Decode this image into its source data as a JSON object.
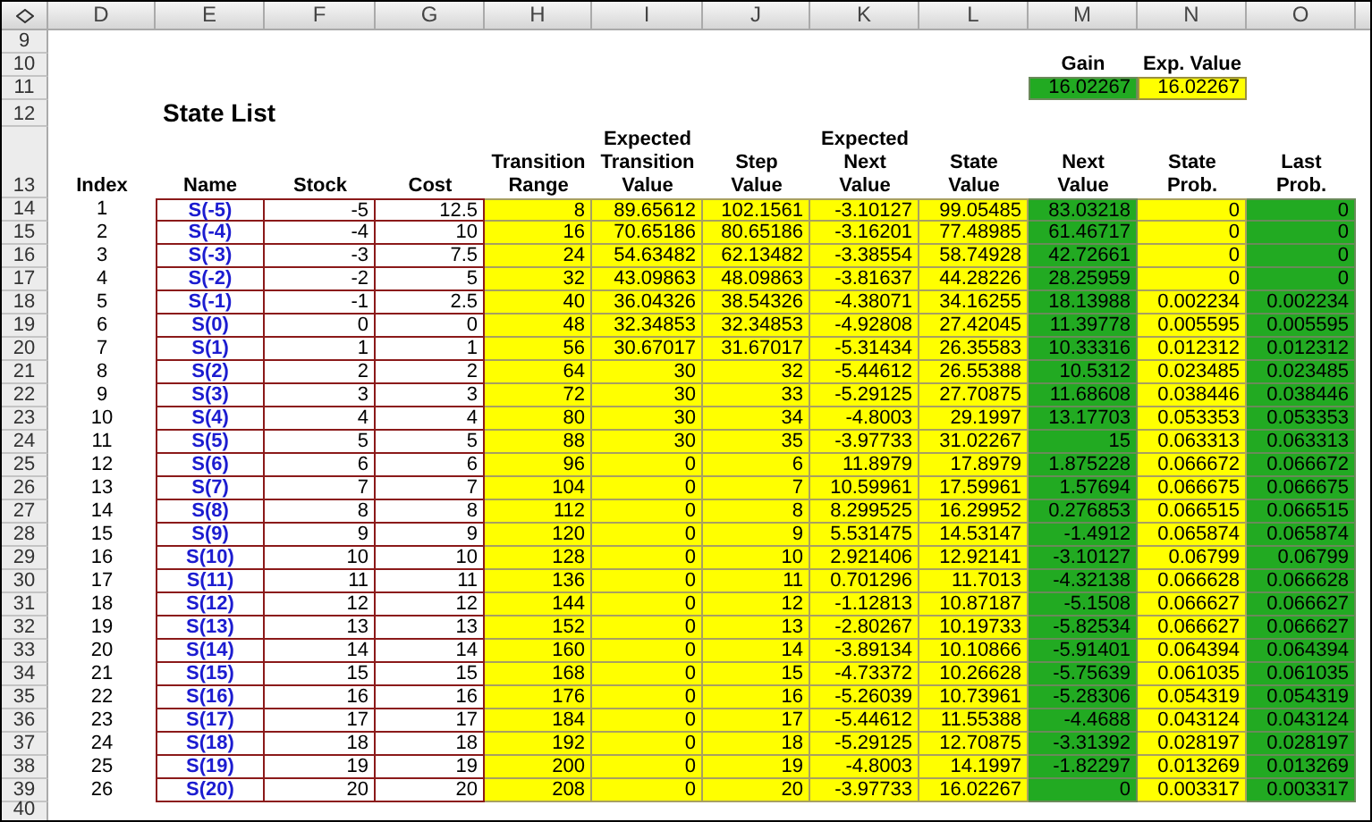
{
  "row_numbers": [
    "9",
    "10",
    "11",
    "12",
    "13",
    "14",
    "15",
    "16",
    "17",
    "18",
    "19",
    "20",
    "21",
    "22",
    "23",
    "24",
    "25",
    "26",
    "27",
    "28",
    "29",
    "30",
    "31",
    "32",
    "33",
    "34",
    "35",
    "36",
    "37",
    "38",
    "39",
    "40"
  ],
  "title": "State List",
  "summary": [
    {
      "label": "Gain",
      "value": "16.02267",
      "kind": "green"
    },
    {
      "label": "Exp. Value",
      "value": "16.02267",
      "kind": "yellow"
    }
  ],
  "columns": [
    {
      "letter": "D",
      "header": "Index",
      "kind": "index"
    },
    {
      "letter": "E",
      "header": "Name",
      "kind": "name"
    },
    {
      "letter": "F",
      "header": "Stock",
      "kind": "boxed"
    },
    {
      "letter": "G",
      "header": "Cost",
      "kind": "boxed"
    },
    {
      "letter": "H",
      "header": "Transition Range",
      "kind": "yellow"
    },
    {
      "letter": "I",
      "header": "Expected Transition Value",
      "kind": "yellow"
    },
    {
      "letter": "J",
      "header": "Step Value",
      "kind": "yellow"
    },
    {
      "letter": "K",
      "header": "Expected Next Value",
      "kind": "yellow"
    },
    {
      "letter": "L",
      "header": "State Value",
      "kind": "yellow"
    },
    {
      "letter": "M",
      "header": "Next Value",
      "kind": "green"
    },
    {
      "letter": "N",
      "header": "State Prob.",
      "kind": "yellow"
    },
    {
      "letter": "O",
      "header": "Last Prob.",
      "kind": "green"
    }
  ],
  "rows": [
    [
      "1",
      "S(-5)",
      "-5",
      "12.5",
      "8",
      "89.65612",
      "102.1561",
      "-3.10127",
      "99.05485",
      "83.03218",
      "0",
      "0"
    ],
    [
      "2",
      "S(-4)",
      "-4",
      "10",
      "16",
      "70.65186",
      "80.65186",
      "-3.16201",
      "77.48985",
      "61.46717",
      "0",
      "0"
    ],
    [
      "3",
      "S(-3)",
      "-3",
      "7.5",
      "24",
      "54.63482",
      "62.13482",
      "-3.38554",
      "58.74928",
      "42.72661",
      "0",
      "0"
    ],
    [
      "4",
      "S(-2)",
      "-2",
      "5",
      "32",
      "43.09863",
      "48.09863",
      "-3.81637",
      "44.28226",
      "28.25959",
      "0",
      "0"
    ],
    [
      "5",
      "S(-1)",
      "-1",
      "2.5",
      "40",
      "36.04326",
      "38.54326",
      "-4.38071",
      "34.16255",
      "18.13988",
      "0.002234",
      "0.002234"
    ],
    [
      "6",
      "S(0)",
      "0",
      "0",
      "48",
      "32.34853",
      "32.34853",
      "-4.92808",
      "27.42045",
      "11.39778",
      "0.005595",
      "0.005595"
    ],
    [
      "7",
      "S(1)",
      "1",
      "1",
      "56",
      "30.67017",
      "31.67017",
      "-5.31434",
      "26.35583",
      "10.33316",
      "0.012312",
      "0.012312"
    ],
    [
      "8",
      "S(2)",
      "2",
      "2",
      "64",
      "30",
      "32",
      "-5.44612",
      "26.55388",
      "10.5312",
      "0.023485",
      "0.023485"
    ],
    [
      "9",
      "S(3)",
      "3",
      "3",
      "72",
      "30",
      "33",
      "-5.29125",
      "27.70875",
      "11.68608",
      "0.038446",
      "0.038446"
    ],
    [
      "10",
      "S(4)",
      "4",
      "4",
      "80",
      "30",
      "34",
      "-4.8003",
      "29.1997",
      "13.17703",
      "0.053353",
      "0.053353"
    ],
    [
      "11",
      "S(5)",
      "5",
      "5",
      "88",
      "30",
      "35",
      "-3.97733",
      "31.02267",
      "15",
      "0.063313",
      "0.063313"
    ],
    [
      "12",
      "S(6)",
      "6",
      "6",
      "96",
      "0",
      "6",
      "11.8979",
      "17.8979",
      "1.875228",
      "0.066672",
      "0.066672"
    ],
    [
      "13",
      "S(7)",
      "7",
      "7",
      "104",
      "0",
      "7",
      "10.59961",
      "17.59961",
      "1.57694",
      "0.066675",
      "0.066675"
    ],
    [
      "14",
      "S(8)",
      "8",
      "8",
      "112",
      "0",
      "8",
      "8.299525",
      "16.29952",
      "0.276853",
      "0.066515",
      "0.066515"
    ],
    [
      "15",
      "S(9)",
      "9",
      "9",
      "120",
      "0",
      "9",
      "5.531475",
      "14.53147",
      "-1.4912",
      "0.065874",
      "0.065874"
    ],
    [
      "16",
      "S(10)",
      "10",
      "10",
      "128",
      "0",
      "10",
      "2.921406",
      "12.92141",
      "-3.10127",
      "0.06799",
      "0.06799"
    ],
    [
      "17",
      "S(11)",
      "11",
      "11",
      "136",
      "0",
      "11",
      "0.701296",
      "11.7013",
      "-4.32138",
      "0.066628",
      "0.066628"
    ],
    [
      "18",
      "S(12)",
      "12",
      "12",
      "144",
      "0",
      "12",
      "-1.12813",
      "10.87187",
      "-5.1508",
      "0.066627",
      "0.066627"
    ],
    [
      "19",
      "S(13)",
      "13",
      "13",
      "152",
      "0",
      "13",
      "-2.80267",
      "10.19733",
      "-5.82534",
      "0.066627",
      "0.066627"
    ],
    [
      "20",
      "S(14)",
      "14",
      "14",
      "160",
      "0",
      "14",
      "-3.89134",
      "10.10866",
      "-5.91401",
      "0.064394",
      "0.064394"
    ],
    [
      "21",
      "S(15)",
      "15",
      "15",
      "168",
      "0",
      "15",
      "-4.73372",
      "10.26628",
      "-5.75639",
      "0.061035",
      "0.061035"
    ],
    [
      "22",
      "S(16)",
      "16",
      "16",
      "176",
      "0",
      "16",
      "-5.26039",
      "10.73961",
      "-5.28306",
      "0.054319",
      "0.054319"
    ],
    [
      "23",
      "S(17)",
      "17",
      "17",
      "184",
      "0",
      "17",
      "-5.44612",
      "11.55388",
      "-4.4688",
      "0.043124",
      "0.043124"
    ],
    [
      "24",
      "S(18)",
      "18",
      "18",
      "192",
      "0",
      "18",
      "-5.29125",
      "12.70875",
      "-3.31392",
      "0.028197",
      "0.028197"
    ],
    [
      "25",
      "S(19)",
      "19",
      "19",
      "200",
      "0",
      "19",
      "-4.8003",
      "14.1997",
      "-1.82297",
      "0.013269",
      "0.013269"
    ],
    [
      "26",
      "S(20)",
      "20",
      "20",
      "208",
      "0",
      "20",
      "-3.97733",
      "16.02267",
      "0",
      "0.003317",
      "0.003317"
    ]
  ]
}
